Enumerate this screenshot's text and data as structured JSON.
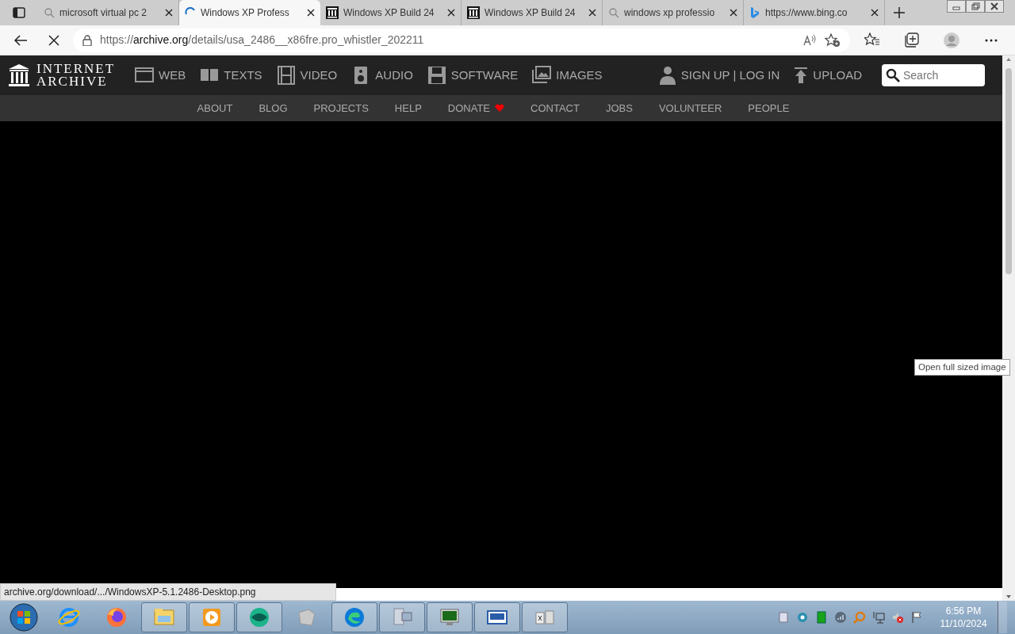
{
  "browser": {
    "tabs": [
      {
        "title": "microsoft virtual pc 2",
        "kind": "search",
        "selected": false
      },
      {
        "title": "Windows XP Profess",
        "kind": "loading",
        "selected": true
      },
      {
        "title": "Windows XP Build 24",
        "kind": "archive",
        "selected": false
      },
      {
        "title": "Windows XP Build 24",
        "kind": "archive",
        "selected": false
      },
      {
        "title": "windows xp professio",
        "kind": "search",
        "selected": false
      },
      {
        "title": "https://www.bing.co",
        "kind": "bing",
        "selected": false
      }
    ],
    "loading": true,
    "address": {
      "scheme": "https://",
      "host": "archive.org",
      "path": "/details/usa_2486__x86fre.pro_whistler_202211"
    }
  },
  "site": {
    "logo": [
      "INTERNET",
      "ARCHIVE"
    ],
    "media_nav": [
      {
        "label": "WEB",
        "kind": "web"
      },
      {
        "label": "TEXTS",
        "kind": "texts"
      },
      {
        "label": "VIDEO",
        "kind": "video"
      },
      {
        "label": "AUDIO",
        "kind": "audio"
      },
      {
        "label": "SOFTWARE",
        "kind": "software"
      },
      {
        "label": "IMAGES",
        "kind": "images"
      }
    ],
    "account": "SIGN UP | LOG IN",
    "upload": "UPLOAD",
    "search": {
      "placeholder": "Search"
    },
    "sub_nav": [
      {
        "label": "ABOUT",
        "heart": false
      },
      {
        "label": "BLOG",
        "heart": false
      },
      {
        "label": "PROJECTS",
        "heart": false
      },
      {
        "label": "HELP",
        "heart": false
      },
      {
        "label": "DONATE",
        "heart": true
      },
      {
        "label": "CONTACT",
        "heart": false
      },
      {
        "label": "JOBS",
        "heart": false
      },
      {
        "label": "VOLUNTEER",
        "heart": false
      },
      {
        "label": "PEOPLE",
        "heart": false
      }
    ]
  },
  "tooltip": "Open full sized image",
  "status_url": "archive.org/download/.../WindowsXP-5.1.2486-Desktop.png",
  "taskbar": {
    "apps": [
      {
        "kind": "ie",
        "running": false
      },
      {
        "kind": "firefox",
        "running": false
      },
      {
        "kind": "explorer",
        "running": true
      },
      {
        "kind": "media",
        "running": true
      },
      {
        "kind": "globe",
        "running": true
      },
      {
        "kind": "cube",
        "running": false
      },
      {
        "kind": "edge",
        "running": true
      },
      {
        "kind": "computer",
        "running": true
      },
      {
        "kind": "monitor",
        "running": true
      },
      {
        "kind": "window",
        "running": true
      },
      {
        "kind": "xp",
        "running": true
      }
    ],
    "clock": {
      "time": "6:56 PM",
      "date": "11/10/2024"
    }
  }
}
